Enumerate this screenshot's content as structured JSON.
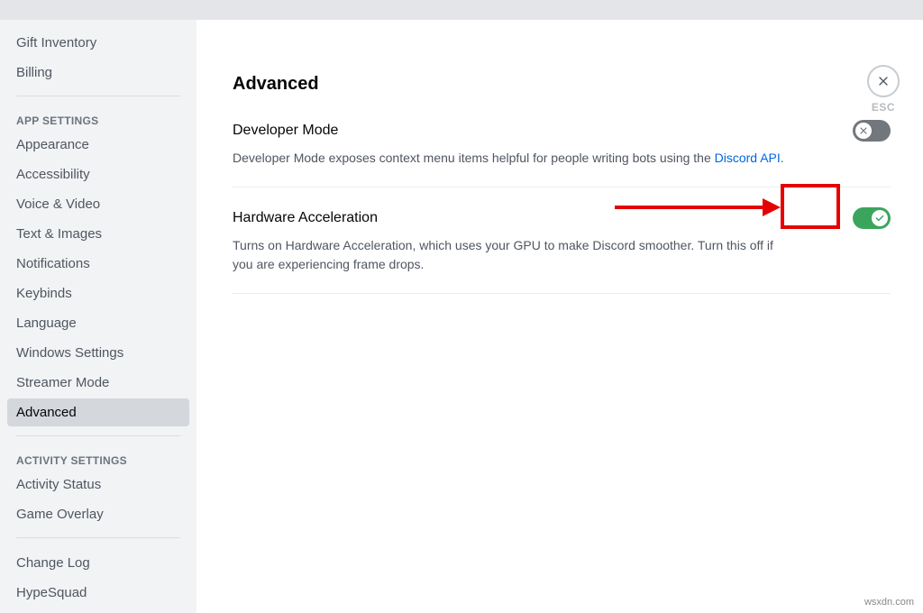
{
  "sidebar": {
    "top_items": [
      {
        "label": "Gift Inventory",
        "name": "sidebar-item-gift-inventory"
      },
      {
        "label": "Billing",
        "name": "sidebar-item-billing"
      }
    ],
    "app_settings_header": "App Settings",
    "app_settings_items": [
      {
        "label": "Appearance",
        "name": "sidebar-item-appearance"
      },
      {
        "label": "Accessibility",
        "name": "sidebar-item-accessibility"
      },
      {
        "label": "Voice & Video",
        "name": "sidebar-item-voice-video"
      },
      {
        "label": "Text & Images",
        "name": "sidebar-item-text-images"
      },
      {
        "label": "Notifications",
        "name": "sidebar-item-notifications"
      },
      {
        "label": "Keybinds",
        "name": "sidebar-item-keybinds"
      },
      {
        "label": "Language",
        "name": "sidebar-item-language"
      },
      {
        "label": "Windows Settings",
        "name": "sidebar-item-windows-settings"
      },
      {
        "label": "Streamer Mode",
        "name": "sidebar-item-streamer-mode"
      },
      {
        "label": "Advanced",
        "name": "sidebar-item-advanced",
        "active": true
      }
    ],
    "activity_settings_header": "Activity Settings",
    "activity_settings_items": [
      {
        "label": "Activity Status",
        "name": "sidebar-item-activity-status"
      },
      {
        "label": "Game Overlay",
        "name": "sidebar-item-game-overlay"
      }
    ],
    "bottom_items": [
      {
        "label": "Change Log",
        "name": "sidebar-item-change-log"
      },
      {
        "label": "HypeSquad",
        "name": "sidebar-item-hypesquad"
      }
    ]
  },
  "page": {
    "title": "Advanced",
    "close_label": "ESC"
  },
  "settings": {
    "developer_mode": {
      "title": "Developer Mode",
      "desc_pre": "Developer Mode exposes context menu items helpful for people writing bots using the ",
      "desc_link": "Discord API",
      "desc_post": ".",
      "enabled": false
    },
    "hardware_acceleration": {
      "title": "Hardware Acceleration",
      "desc": "Turns on Hardware Acceleration, which uses your GPU to make Discord smoother. Turn this off if you are experiencing frame drops.",
      "enabled": true
    }
  },
  "watermark": "wsxdn.com"
}
